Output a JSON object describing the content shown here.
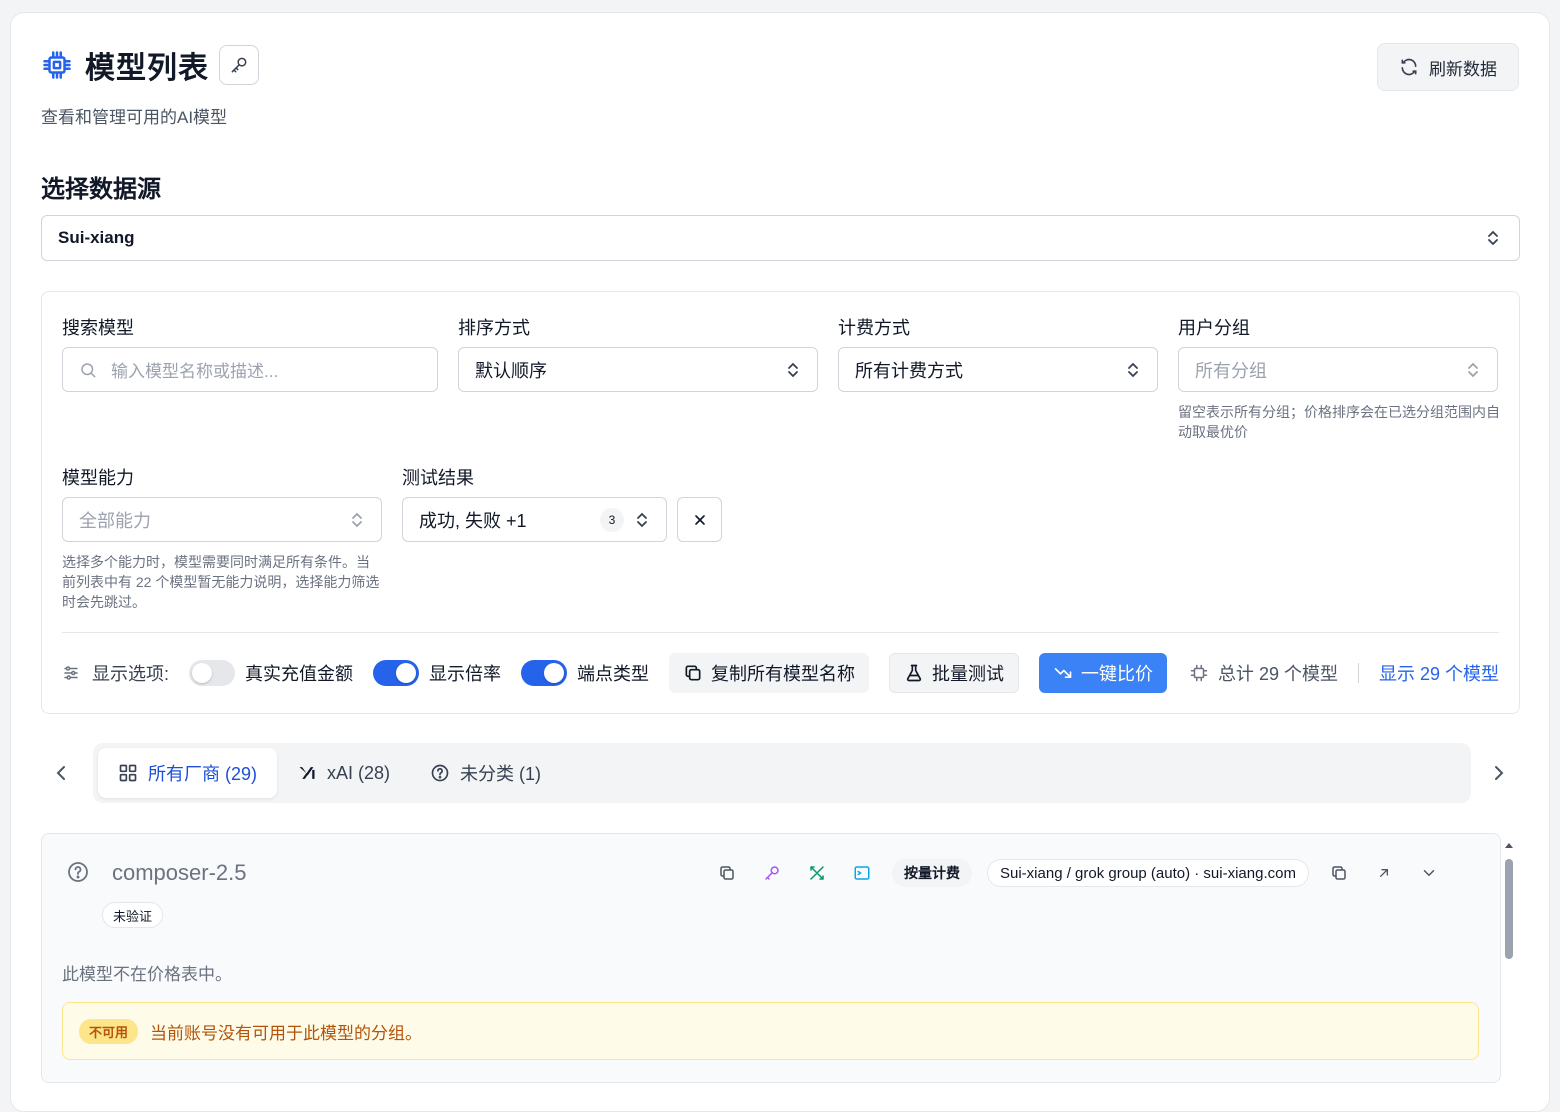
{
  "header": {
    "title": "模型列表",
    "subtitle": "查看和管理可用的AI模型",
    "refresh_label": "刷新数据"
  },
  "source": {
    "section_title": "选择数据源",
    "selected": "Sui-xiang"
  },
  "filters": {
    "search": {
      "label": "搜索模型",
      "placeholder": "输入模型名称或描述..."
    },
    "sort": {
      "label": "排序方式",
      "value": "默认顺序"
    },
    "billing": {
      "label": "计费方式",
      "value": "所有计费方式"
    },
    "group": {
      "label": "用户分组",
      "placeholder": "所有分组",
      "hint": "留空表示所有分组；价格排序会在已选分组范围内自动取最优价"
    },
    "capability": {
      "label": "模型能力",
      "placeholder": "全部能力",
      "hint": "选择多个能力时，模型需要同时满足所有条件。当前列表中有 22 个模型暂无能力说明，选择能力筛选时会先跳过。"
    },
    "test_result": {
      "label": "测试结果",
      "value": "成功, 失败 +1",
      "count": "3"
    }
  },
  "options": {
    "label": "显示选项:",
    "toggles": [
      {
        "label": "真实充值金额",
        "on": false
      },
      {
        "label": "显示倍率",
        "on": true
      },
      {
        "label": "端点类型",
        "on": true
      }
    ],
    "copy_label": "复制所有模型名称",
    "batch_test_label": "批量测试",
    "compare_label": "一键比价",
    "total_label": "总计 29 个模型",
    "show_label": "显示 29 个模型"
  },
  "tabs": [
    {
      "label": "所有厂商 (29)",
      "icon": "grid-icon",
      "active": true
    },
    {
      "label": "xAI (28)",
      "icon": "xai-logo-icon",
      "active": false
    },
    {
      "label": "未分类 (1)",
      "icon": "question-circle-icon",
      "active": false
    }
  ],
  "model_card": {
    "name": "composer-2.5",
    "status_badge": "未验证",
    "billing_badge": "按量计费",
    "endpoint": "Sui-xiang / grok group (auto) · sui-xiang.com",
    "price_note": "此模型不在价格表中。",
    "warning_badge": "不可用",
    "warning_text": "当前账号没有可用于此模型的分组。"
  },
  "colors": {
    "accent": "#2563eb",
    "compare_button": "#3b82f6",
    "warning_bg": "#fefce8",
    "warning_text": "#b45309"
  }
}
